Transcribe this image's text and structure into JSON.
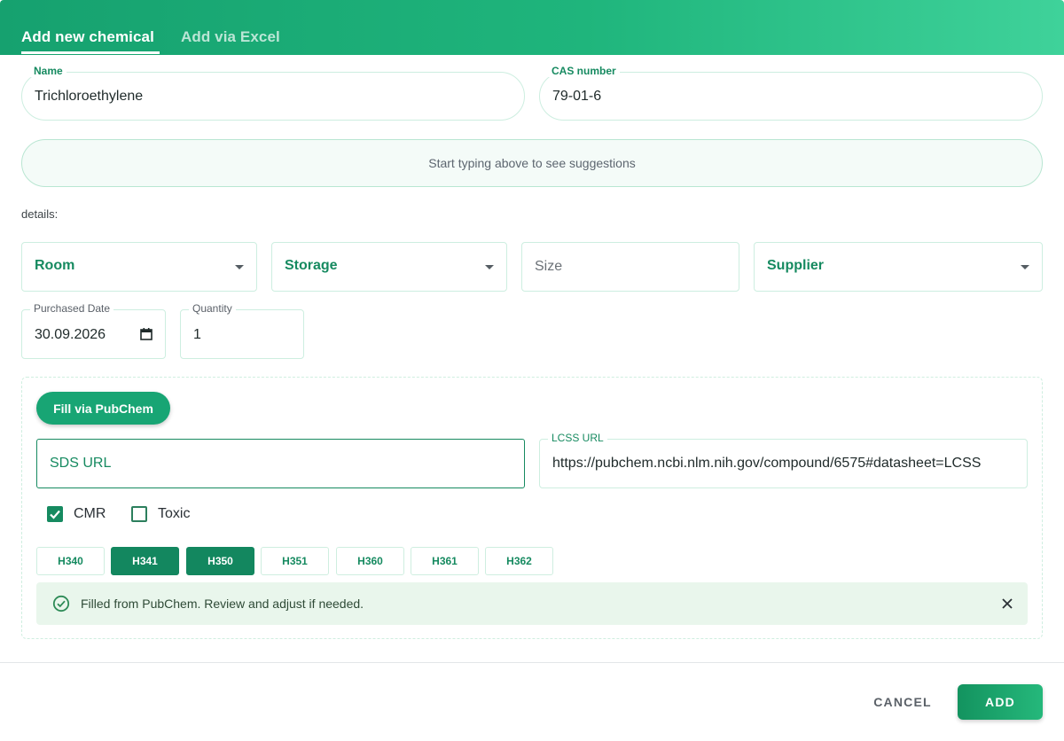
{
  "tabs": {
    "active": "Add new chemical",
    "inactive": "Add via Excel"
  },
  "name_field": {
    "label": "Name",
    "value": "Trichloroethylene"
  },
  "cas_field": {
    "label": "CAS number",
    "value": "79-01-6"
  },
  "suggestions": {
    "text": "Start typing above to see suggestions"
  },
  "details": {
    "label": "details:"
  },
  "selects": {
    "room": "Room",
    "storage": "Storage",
    "size_placeholder": "Size",
    "supplier": "Supplier"
  },
  "purchased_date": {
    "label": "Purchased Date",
    "value": "30.09.2026"
  },
  "quantity": {
    "label": "Quantity",
    "value": "1"
  },
  "pubchem": {
    "button_label": "Fill via PubChem",
    "sds_placeholder": "SDS URL",
    "lcss_label": "LCSS URL",
    "lcss_value": "https://pubchem.ncbi.nlm.nih.gov/compound/6575#datasheet=LCSS",
    "cmr": {
      "label": "CMR",
      "checked": true
    },
    "toxic": {
      "label": "Toxic",
      "checked": false
    },
    "hazards": [
      {
        "code": "H340",
        "selected": false
      },
      {
        "code": "H341",
        "selected": true
      },
      {
        "code": "H350",
        "selected": true
      },
      {
        "code": "H351",
        "selected": false
      },
      {
        "code": "H360",
        "selected": false
      },
      {
        "code": "H361",
        "selected": false
      },
      {
        "code": "H362",
        "selected": false
      }
    ],
    "alert_text": "Filled from PubChem. Review and adjust if needed."
  },
  "footer": {
    "cancel_label": "CANCEL",
    "add_label": "ADD"
  },
  "colors": {
    "accent": "#168a60",
    "header_start": "#16a16f",
    "header_end": "#3fd29a",
    "alert_bg": "#e9f6ec"
  }
}
